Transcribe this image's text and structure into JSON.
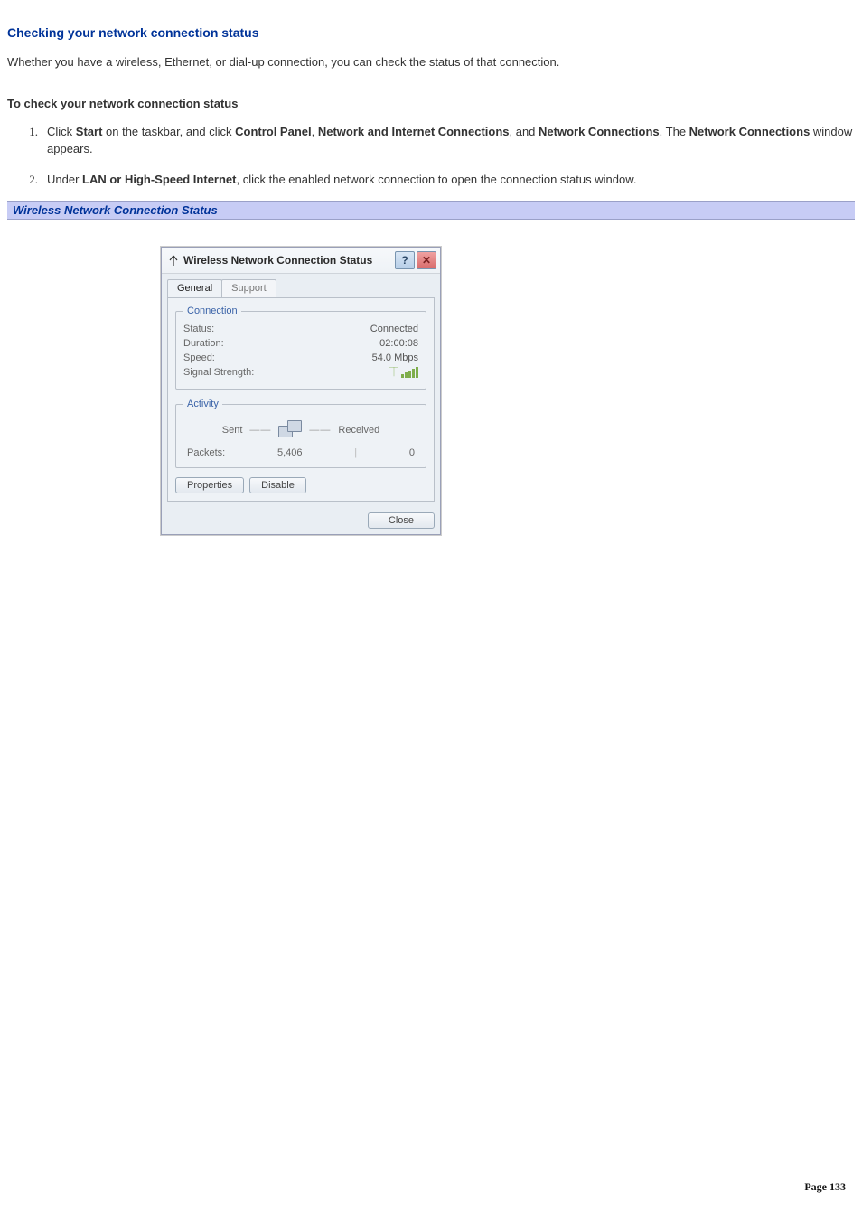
{
  "heading": "Checking your network connection status",
  "intro": "Whether you have a wireless, Ethernet, or dial-up connection, you can check the status of that connection.",
  "sub_heading": "To check your network connection status",
  "steps": [
    {
      "num": "1.",
      "pre": "Click ",
      "b1": "Start",
      "mid1": " on the taskbar, and click ",
      "b2": "Control Panel",
      "sep1": ", ",
      "b3": "Network and Internet Connections",
      "sep2": ", and ",
      "b4": "Network Connections",
      "mid2": ". The ",
      "b5": "Network Connections",
      "post": " window appears."
    },
    {
      "num": "2.",
      "pre": "Under ",
      "b1": "LAN or High-Speed Internet",
      "post": ", click the enabled network connection to open the connection status window."
    }
  ],
  "caption": "Wireless Network Connection Status",
  "dialog": {
    "title": "Wireless Network Connection Status",
    "tabs": {
      "general": "General",
      "support": "Support"
    },
    "connection": {
      "legend": "Connection",
      "status_k": "Status:",
      "status_v": "Connected",
      "duration_k": "Duration:",
      "duration_v": "02:00:08",
      "speed_k": "Speed:",
      "speed_v": "54.0 Mbps",
      "signal_k": "Signal Strength:"
    },
    "activity": {
      "legend": "Activity",
      "sent": "Sent",
      "received": "Received",
      "packets_k": "Packets:",
      "packets_sent": "5,406",
      "packets_recv": "0"
    },
    "buttons": {
      "properties": "Properties",
      "disable": "Disable",
      "close": "Close"
    }
  },
  "page_label": "Page ",
  "page_number": "133"
}
